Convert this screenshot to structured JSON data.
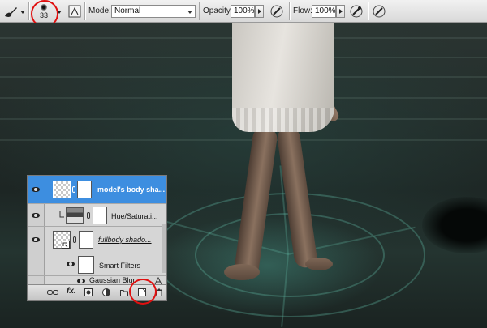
{
  "options_bar": {
    "brush_size": "33",
    "mode_label": "Mode:",
    "mode_value": "Normal",
    "opacity_label": "Opacity:",
    "opacity_value": "100%",
    "flow_label": "Flow:",
    "flow_value": "100%"
  },
  "layers": [
    {
      "name": "model's body sha...",
      "selected": true
    },
    {
      "name": "Hue/Saturati...",
      "selected": false
    },
    {
      "name": "fullbody shado...",
      "selected": false
    },
    {
      "name": "Smart Filters",
      "selected": false
    },
    {
      "name": "Gaussian Blur",
      "selected": false
    }
  ],
  "footer": {
    "fx_label": "fx."
  },
  "colors": {
    "selection": "#3d8ee0",
    "highlight_circle": "#e01010"
  }
}
